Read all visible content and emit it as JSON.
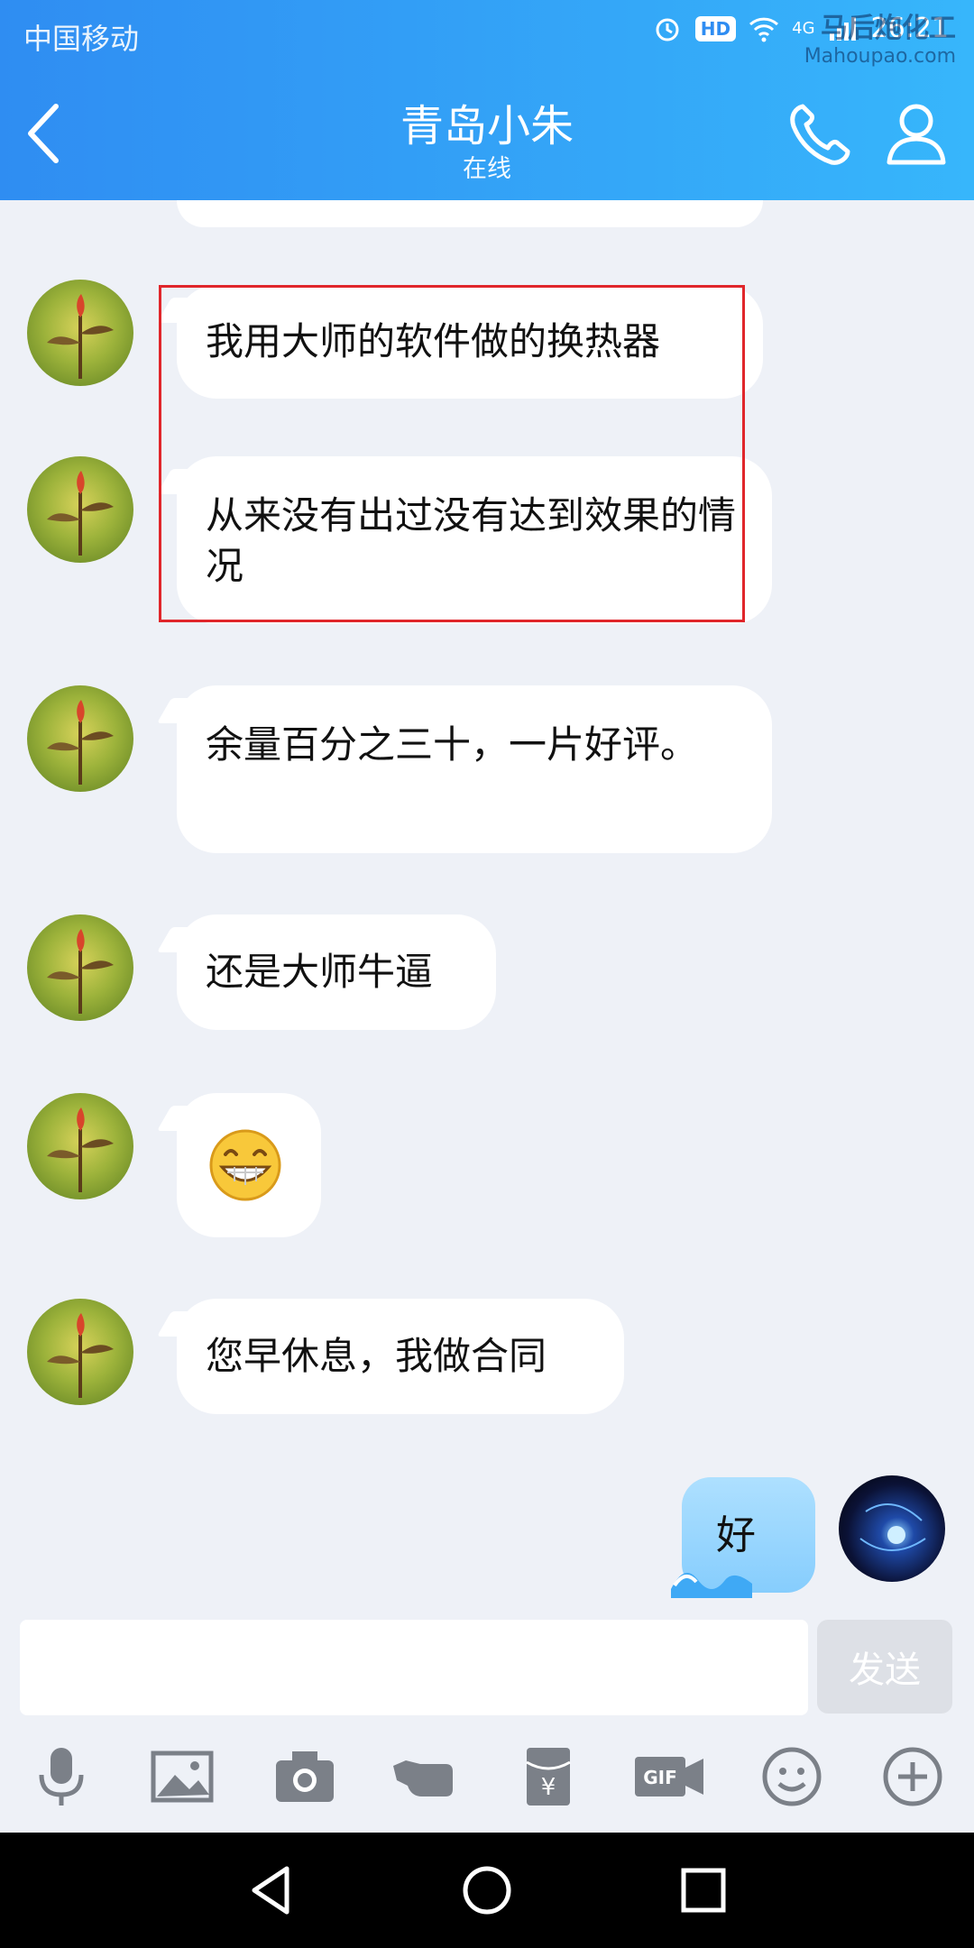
{
  "status_bar": {
    "carrier": "中国移动",
    "hd": "HD",
    "network": "4G",
    "time": "26:21"
  },
  "watermark": {
    "line1": "马后炮化工",
    "line2": "Mahoupao.com"
  },
  "header": {
    "title": "青岛小朱",
    "status": "在线"
  },
  "messages": [
    {
      "side": "left",
      "text": "我用大师的软件做的换热器"
    },
    {
      "side": "left",
      "text": "从来没有出过没有达到效果的情况"
    },
    {
      "side": "left",
      "text": "余量百分之三十，一片好评。"
    },
    {
      "side": "left",
      "text": "还是大师牛逼"
    },
    {
      "side": "left",
      "emoji": "grinning-emoji"
    },
    {
      "side": "left",
      "text": "您早休息，我做合同"
    },
    {
      "side": "right",
      "text": "好"
    }
  ],
  "input": {
    "placeholder": "",
    "send_label": "发送"
  },
  "toolbar": [
    "microphone-icon",
    "image-icon",
    "camera-icon",
    "poke-icon",
    "red-packet-icon",
    "gif-icon",
    "emoji-icon",
    "plus-icon"
  ],
  "colors": {
    "header_start": "#2f8df2",
    "header_end": "#37b6fb",
    "highlight": "#e0262b",
    "chat_bg": "#eef1f7"
  }
}
